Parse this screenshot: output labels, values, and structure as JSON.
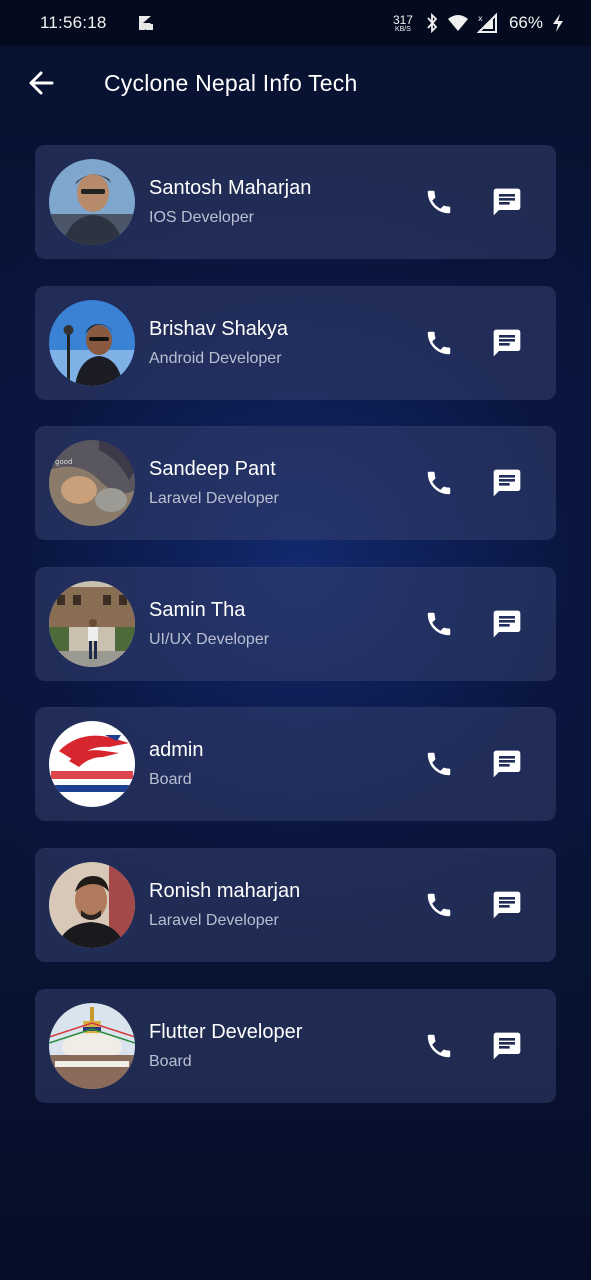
{
  "status_bar": {
    "time": "11:56:18",
    "net_speed_value": "317",
    "net_speed_unit": "KB/S",
    "battery": "66%"
  },
  "header": {
    "title": "Cyclone Nepal Info Tech"
  },
  "contacts": [
    {
      "name": "Santosh Maharjan",
      "role": "IOS Developer"
    },
    {
      "name": "Brishav Shakya",
      "role": "Android Developer"
    },
    {
      "name": "Sandeep Pant",
      "role": "Laravel Developer"
    },
    {
      "name": "Samin Tha",
      "role": "UI/UX Developer"
    },
    {
      "name": "admin",
      "role": "Board"
    },
    {
      "name": "Ronish maharjan",
      "role": "Laravel Developer"
    },
    {
      "name": "Flutter Developer",
      "role": "Board"
    }
  ],
  "icons": {
    "back": "arrow-back-icon",
    "call": "phone-icon",
    "message": "message-icon"
  },
  "colors": {
    "card_background": "#2a3663",
    "subtitle": "#b9bfd2",
    "background": "#0a1742"
  }
}
